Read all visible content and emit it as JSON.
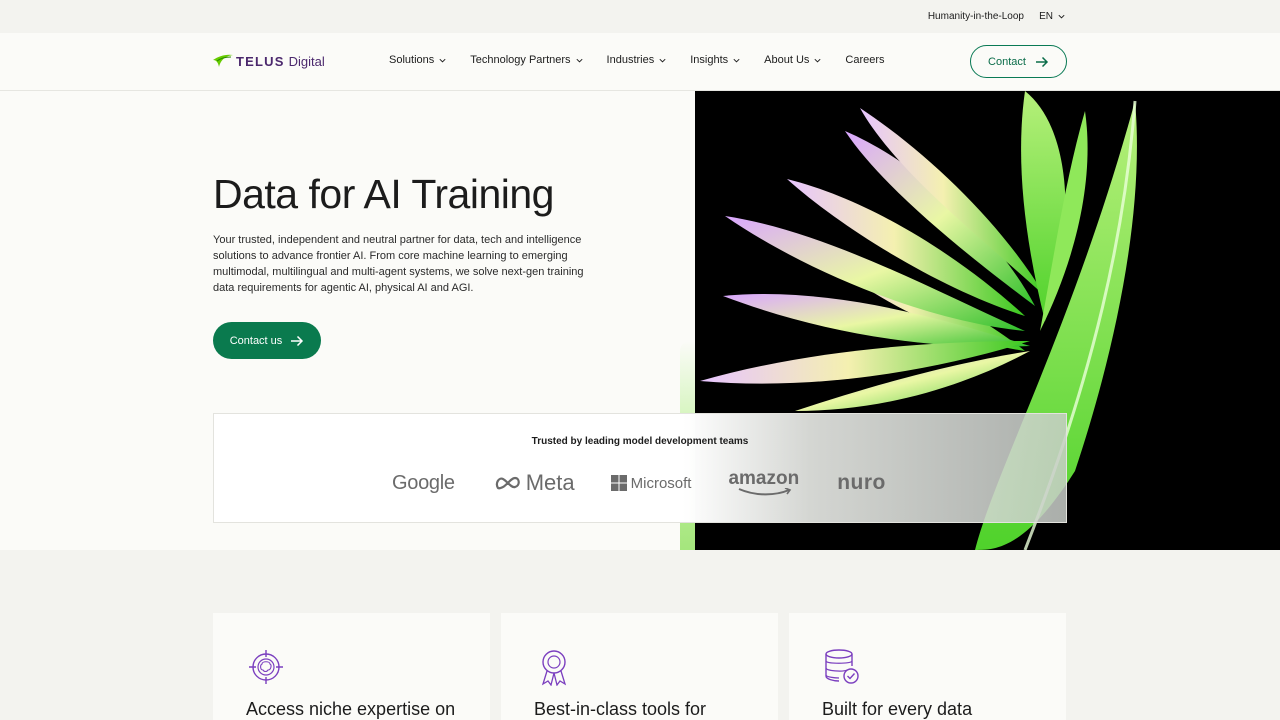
{
  "utility": {
    "humanity_link": "Humanity-in-the-Loop",
    "language": "EN"
  },
  "nav": {
    "brand": "TELUS",
    "brand_sub": "Digital",
    "items": [
      {
        "label": "Solutions",
        "has_dropdown": true
      },
      {
        "label": "Technology Partners",
        "has_dropdown": true
      },
      {
        "label": "Industries",
        "has_dropdown": true
      },
      {
        "label": "Insights",
        "has_dropdown": true
      },
      {
        "label": "About Us",
        "has_dropdown": true
      },
      {
        "label": "Careers",
        "has_dropdown": false
      }
    ],
    "contact_label": "Contact"
  },
  "hero": {
    "title": "Data for AI Training",
    "description": "Your trusted, independent and neutral partner for data, tech and intelligence solutions to advance frontier AI. From core machine learning to emerging multimodal, multilingual and multi-agent systems, we solve next-gen training data requirements for agentic AI, physical AI and AGI.",
    "cta_label": "Contact us"
  },
  "trusted": {
    "title": "Trusted by leading model development teams",
    "logos": [
      "Google",
      "Meta",
      "Microsoft",
      "amazon",
      "nuro"
    ]
  },
  "cards": [
    {
      "title": "Access niche expertise on",
      "icon": "target-brain-icon"
    },
    {
      "title": "Best-in-class tools for",
      "icon": "award-ribbon-icon"
    },
    {
      "title": "Built for every data",
      "icon": "database-check-icon"
    }
  ],
  "colors": {
    "accent_green": "#0a7a4e",
    "brand_purple": "#4b286d",
    "icon_purple": "#7b3fbf",
    "logo_green": "#66cc00"
  }
}
